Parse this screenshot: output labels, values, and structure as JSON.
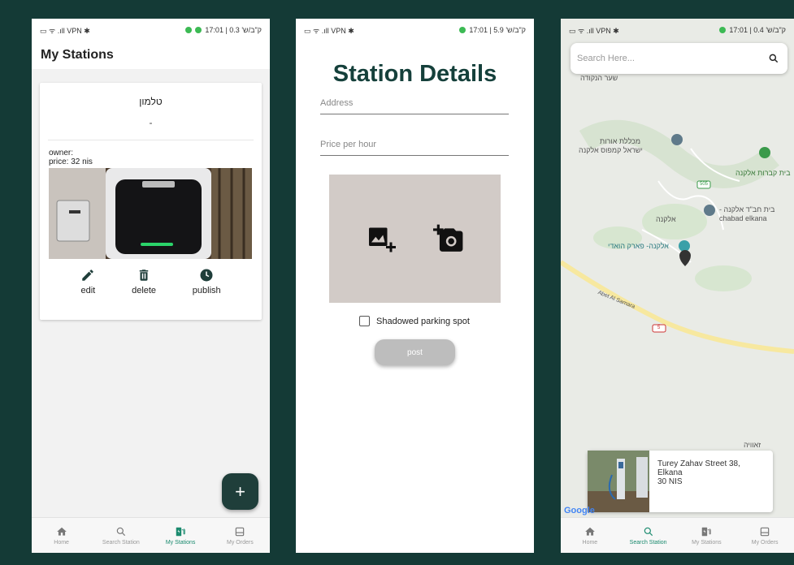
{
  "screen1": {
    "status": {
      "left": "▭ ᯤ .ıll VPN ✱",
      "right": "ק\"ב/ש' 0.3 | 17:01"
    },
    "title": "My Stations",
    "card": {
      "name": "טלמון",
      "dash": "-",
      "owner_label": "owner:",
      "price_label": "price: 32 nis",
      "actions": {
        "edit": "edit",
        "delete": "delete",
        "publish": "publish"
      }
    },
    "fab_label": "+"
  },
  "screen2": {
    "status": {
      "left": "▭ ᯤ .ıll VPN ✱",
      "right": "ק\"ב/ש' 5.9 | 17:01"
    },
    "title": "Station Details",
    "address_placeholder": "Address",
    "price_placeholder": "Price per hour",
    "checkbox_label": "Shadowed parking spot",
    "post_label": "post"
  },
  "screen3": {
    "status": {
      "left": "▭ ᯤ .ıll VPN ✱",
      "right": "ק\"ב/ש' 0.4 | 17:01"
    },
    "search_placeholder": "Search Here...",
    "map_labels": {
      "l1": "שער הנקודה",
      "l2": "מכללת אורות",
      "l3": "ישראל קמפוס אלקנה",
      "l4": "בית קברות אלקנה",
      "l5": "בית חב\"ד אלקנה -",
      "l6": "chabad elkana",
      "l7": "אלקנה",
      "l8": "אלקנה- פארק הואדי",
      "l9": "Abet Al Samara",
      "l10": "זאוויה",
      "road_505": "505",
      "road_5": "5"
    },
    "station": {
      "address1": "Turey Zahav Street 38,",
      "address2": "Elkana",
      "price": "30 NIS"
    },
    "google": "Google"
  },
  "nav": {
    "home": "Home",
    "search": "Search Station",
    "stations": "My Stations",
    "orders": "My Orders"
  },
  "colors": {
    "primary_dark": "#15403b",
    "accent": "#1a8a6e",
    "background": "#143a36"
  }
}
